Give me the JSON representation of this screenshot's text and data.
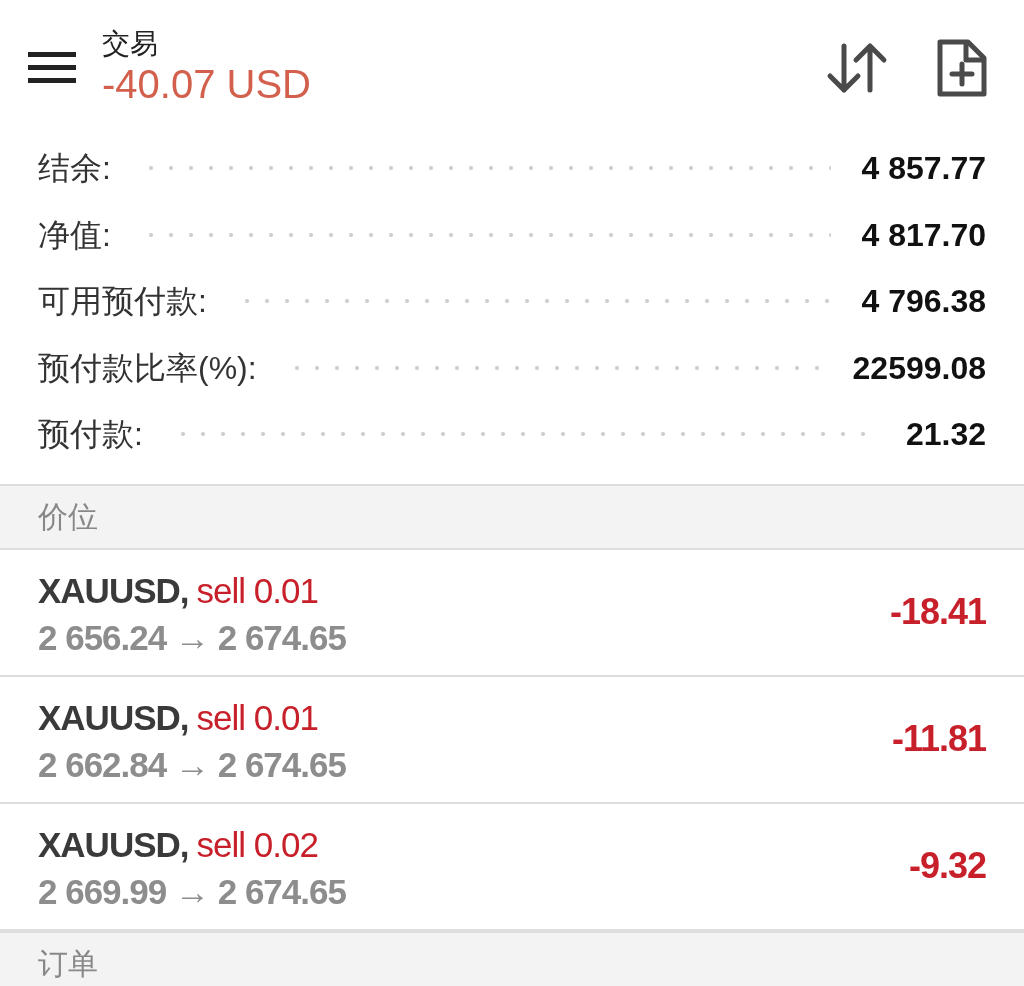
{
  "header": {
    "title": "交易",
    "profit": "-40.07 USD"
  },
  "summary": [
    {
      "label": "结余:",
      "value": "4 857.77"
    },
    {
      "label": "净值:",
      "value": "4 817.70"
    },
    {
      "label": "可用预付款:",
      "value": "4 796.38"
    },
    {
      "label": "预付款比率(%):",
      "value": "22599.08"
    },
    {
      "label": "预付款:",
      "value": "21.32"
    }
  ],
  "sections": [
    {
      "title": "价位",
      "positions": [
        {
          "symbol": "XAUUSD,",
          "order": "sell 0.01",
          "prices": "2 656.24 → 2 674.65",
          "profit": "-18.41"
        },
        {
          "symbol": "XAUUSD,",
          "order": "sell 0.01",
          "prices": "2 662.84 → 2 674.65",
          "profit": "-11.81"
        },
        {
          "symbol": "XAUUSD,",
          "order": "sell 0.02",
          "prices": "2 669.99 → 2 674.65",
          "profit": "-9.32"
        }
      ]
    },
    {
      "title": "订单"
    }
  ]
}
